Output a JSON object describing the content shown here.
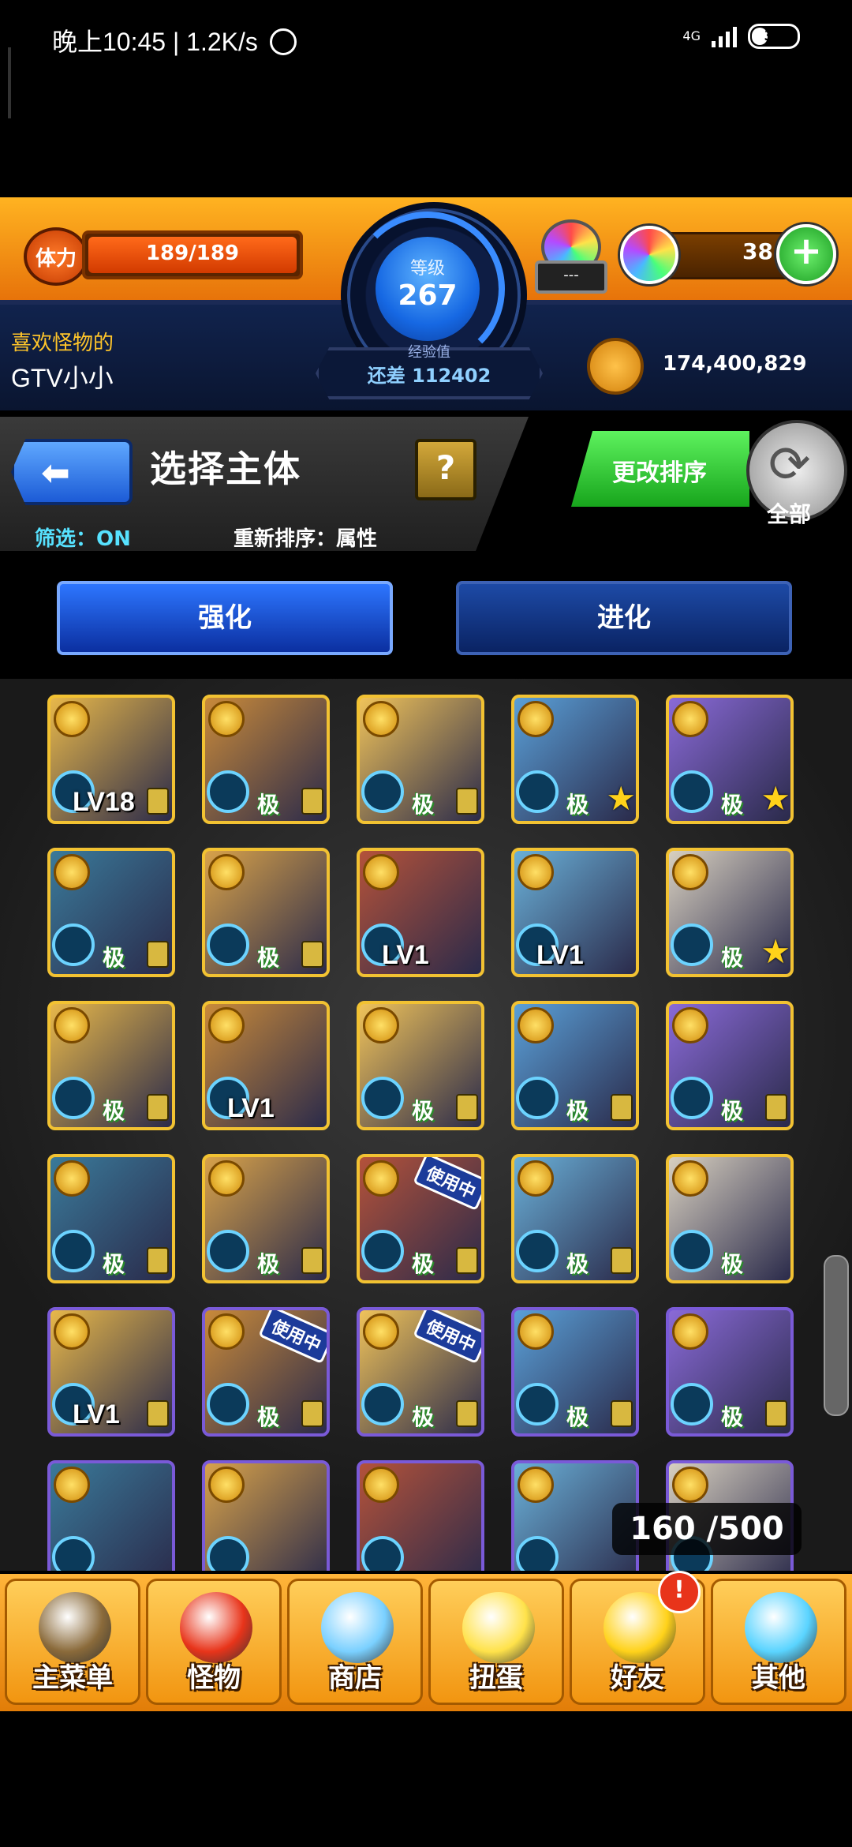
{
  "status_bar": {
    "time": "晚上10:45 | 1.2K/s",
    "network": "4G",
    "battery": "31"
  },
  "header": {
    "stamina_label": "体力",
    "stamina": "189/189",
    "stamina_fraction": 1.0,
    "level_label": "等级",
    "level": "267",
    "exp_label": "经验值",
    "exp_remaining": "还差 112402",
    "egg_count": "---",
    "orb_count": "38",
    "favorite_label": "喜欢怪物的",
    "player_name": "GTV小小",
    "gold": "174,400,829"
  },
  "select_panel": {
    "title": "选择主体",
    "help": "?",
    "filter": "筛选：ON",
    "resort": "重新排序：属性",
    "sort_button": "更改排序",
    "all_label": "全部"
  },
  "tabs": [
    {
      "label": "强化",
      "active": true
    },
    {
      "label": "进化",
      "active": false
    }
  ],
  "monsters": [
    {
      "label": "LV18",
      "kind": "lvl",
      "lock": true,
      "star": false,
      "inuse": false
    },
    {
      "label": "极",
      "kind": "tag",
      "lock": true,
      "star": false,
      "inuse": false
    },
    {
      "label": "极",
      "kind": "tag",
      "lock": true,
      "star": false,
      "inuse": false
    },
    {
      "label": "极",
      "kind": "tag",
      "lock": false,
      "star": true,
      "inuse": false
    },
    {
      "label": "极",
      "kind": "tag",
      "lock": false,
      "star": true,
      "inuse": false
    },
    {
      "label": "极",
      "kind": "tag",
      "lock": true,
      "star": false,
      "inuse": false
    },
    {
      "label": "极",
      "kind": "tag",
      "lock": true,
      "star": false,
      "inuse": false
    },
    {
      "label": "LV1",
      "kind": "lvl",
      "lock": false,
      "star": false,
      "inuse": false
    },
    {
      "label": "LV1",
      "kind": "lvl",
      "lock": false,
      "star": false,
      "inuse": false
    },
    {
      "label": "极",
      "kind": "tag",
      "lock": false,
      "star": true,
      "inuse": false
    },
    {
      "label": "极",
      "kind": "tag",
      "lock": true,
      "star": false,
      "inuse": false
    },
    {
      "label": "LV1",
      "kind": "lvl",
      "lock": false,
      "star": false,
      "inuse": false
    },
    {
      "label": "极",
      "kind": "tag",
      "lock": true,
      "star": false,
      "inuse": false
    },
    {
      "label": "极",
      "kind": "tag",
      "lock": true,
      "star": false,
      "inuse": false
    },
    {
      "label": "极",
      "kind": "tag",
      "lock": true,
      "star": false,
      "inuse": false
    },
    {
      "label": "极",
      "kind": "tag",
      "lock": true,
      "star": false,
      "inuse": false
    },
    {
      "label": "极",
      "kind": "tag",
      "lock": true,
      "star": false,
      "inuse": false
    },
    {
      "label": "极",
      "kind": "tag",
      "lock": true,
      "star": false,
      "inuse": true
    },
    {
      "label": "极",
      "kind": "tag",
      "lock": true,
      "star": false,
      "inuse": false
    },
    {
      "label": "极",
      "kind": "tag",
      "lock": false,
      "star": false,
      "inuse": false
    },
    {
      "label": "LV1",
      "kind": "lvl",
      "lock": true,
      "star": false,
      "inuse": false
    },
    {
      "label": "极",
      "kind": "tag",
      "lock": true,
      "star": false,
      "inuse": true
    },
    {
      "label": "极",
      "kind": "tag",
      "lock": true,
      "star": false,
      "inuse": true
    },
    {
      "label": "极",
      "kind": "tag",
      "lock": true,
      "star": false,
      "inuse": false
    },
    {
      "label": "极",
      "kind": "tag",
      "lock": true,
      "star": false,
      "inuse": false
    },
    {
      "label": "",
      "kind": "tag",
      "lock": false,
      "star": false,
      "inuse": false
    },
    {
      "label": "",
      "kind": "tag",
      "lock": false,
      "star": false,
      "inuse": false
    },
    {
      "label": "",
      "kind": "tag",
      "lock": false,
      "star": false,
      "inuse": false
    },
    {
      "label": "",
      "kind": "tag",
      "lock": false,
      "star": false,
      "inuse": false
    },
    {
      "label": "",
      "kind": "tag",
      "lock": false,
      "star": false,
      "inuse": false
    }
  ],
  "inuse_label": "使用中",
  "monster_count": "160 /500",
  "nav": [
    {
      "label": "主菜单",
      "icon": "gate-icon",
      "color": "#8a6a3a"
    },
    {
      "label": "怪物",
      "icon": "dragon-icon",
      "color": "#e8341a"
    },
    {
      "label": "商店",
      "icon": "rainbow-orb-icon",
      "color": "#7ad0ff"
    },
    {
      "label": "扭蛋",
      "icon": "egg-icon",
      "color": "#ffe24a"
    },
    {
      "label": "好友",
      "icon": "friends-icon",
      "color": "#ffd21a"
    },
    {
      "label": "其他",
      "icon": "question-icon",
      "color": "#5ad4ff"
    }
  ],
  "nav_notification": "!"
}
